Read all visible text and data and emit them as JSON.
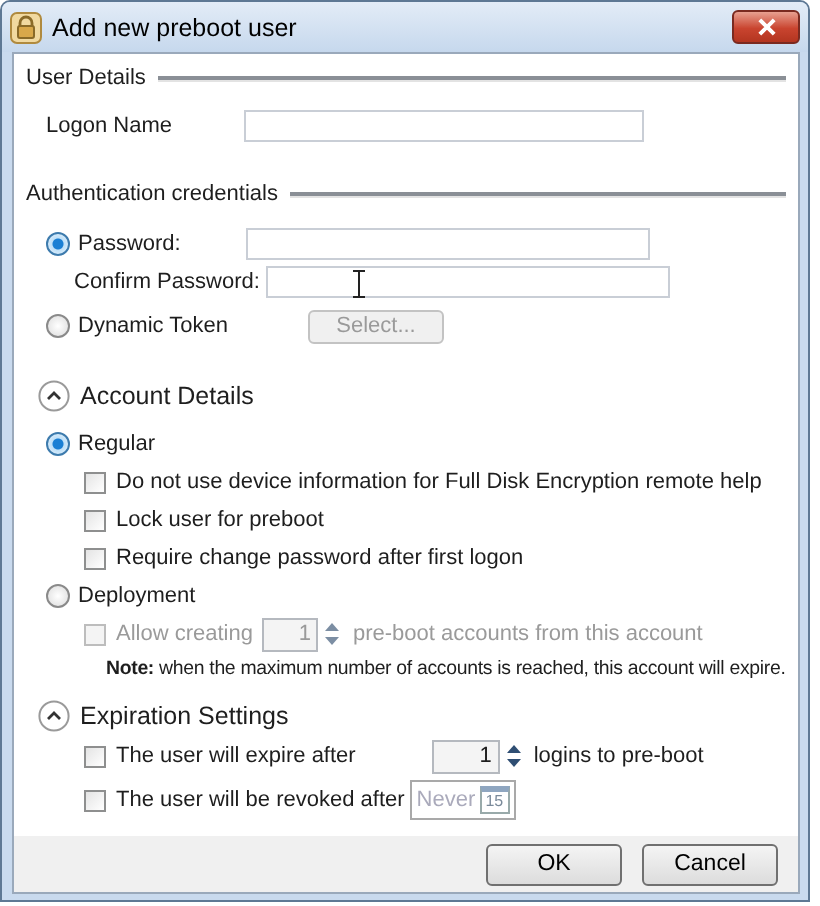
{
  "window": {
    "title": "Add new preboot user"
  },
  "user_details": {
    "heading": "User Details",
    "logon_label": "Logon Name"
  },
  "authentication": {
    "heading": "Authentication credentials",
    "options": [
      {
        "kind": "password",
        "label": "Password:",
        "selected": true,
        "confirm_label": "Confirm Password:"
      },
      {
        "kind": "token",
        "label": "Dynamic Token",
        "selected": false,
        "button": {
          "label": "Select...",
          "disabled": true
        }
      }
    ]
  },
  "account_details": {
    "heading": "Account Details",
    "expanded": true,
    "types": [
      {
        "label": "Regular",
        "selected": true,
        "items": [
          {
            "kind": "checkbox",
            "label": "Do not use device information for Full Disk Encryption remote help",
            "checked": false,
            "disabled": false
          },
          {
            "kind": "checkbox",
            "label": "Lock user for preboot",
            "checked": false,
            "disabled": false
          },
          {
            "kind": "checkbox",
            "label": "Require change password after first logon",
            "checked": false,
            "disabled": false
          }
        ]
      },
      {
        "label": "Deployment",
        "selected": false,
        "items": [
          {
            "kind": "counter",
            "label": "Allow creating",
            "value": "1",
            "suffix": "pre-boot accounts from this account",
            "checked": false,
            "disabled": true
          },
          {
            "kind": "note",
            "text": "**Note:** when the maximum number of accounts is reached, this account will expire."
          }
        ]
      }
    ]
  },
  "expiration_settings": {
    "heading": "Expiration Settings",
    "expanded": true,
    "items": [
      {
        "kind": "counter",
        "label": "The user will expire after",
        "value": "1",
        "suffix": "logins to pre-boot",
        "checked": false,
        "disabled": false
      },
      {
        "kind": "date",
        "label": "The user will be revoked after",
        "placeholder": "Never",
        "calendar_day": "15",
        "checked": false,
        "disabled": false
      }
    ]
  },
  "buttons": [
    {
      "label": "OK"
    },
    {
      "label": "Cancel"
    }
  ]
}
